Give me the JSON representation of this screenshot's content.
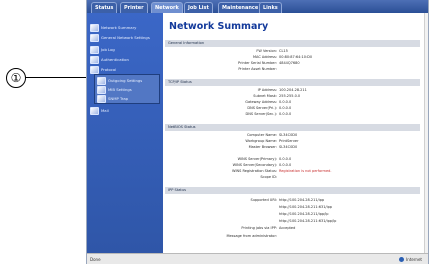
{
  "callout": "①",
  "tabs": [
    "Status",
    "Printer",
    "Network",
    "Job List",
    "Maintenance",
    "Links"
  ],
  "sidebar": {
    "items": [
      "Network Summary",
      "General Network Settings",
      "Job Log",
      "Authentication",
      "Protocol"
    ],
    "sub_items": [
      "Outgoing Settings",
      "MIB Settings",
      "SNMP Trap"
    ],
    "last_item": "Mail"
  },
  "title": "Network Summary",
  "general": {
    "header": "General Information",
    "rows": [
      [
        "FW Version:",
        "CL15"
      ],
      [
        "MAC Address:",
        "00:80:87:64:10:D0"
      ],
      [
        "Printer Serial Number:",
        "4844Q7680"
      ],
      [
        "Printer Asset Number:",
        ""
      ]
    ]
  },
  "tcpip": {
    "header": "TCP/IP Status",
    "rows": [
      [
        "IP Address:",
        "100.204.28.211"
      ],
      [
        "Subnet Mask:",
        "255.255.0.0"
      ],
      [
        "Gateway Address:",
        "0.0.0.0"
      ],
      [
        "DNS Server(Pri.):",
        "0.0.0.0"
      ],
      [
        "DNS Server(Sec.):",
        "0.0.0.0"
      ]
    ]
  },
  "netbios": {
    "header": "NetBIOS Status",
    "rows": [
      [
        "Computer Name:",
        "SL34C0D0"
      ],
      [
        "Workgroup Name:",
        "PrintServer"
      ],
      [
        "Master Browser:",
        "SL34C0D0"
      ],
      [
        "",
        ""
      ],
      [
        "WINS Server(Primary):",
        "0.0.0.0"
      ],
      [
        "WINS Server(Secondary):",
        "0.0.0.0"
      ],
      [
        "WINS Registration Status:",
        "Registration is not performed."
      ],
      [
        "Scope ID:",
        ""
      ]
    ]
  },
  "ipp": {
    "header": "IPP Status",
    "rows": [
      [
        "Supported URI:",
        "http://100.204.28.211/ipp"
      ],
      [
        "",
        "http://100.204.28.211:631/ipp"
      ],
      [
        "",
        "http://100.204.28.211/ipp/lp"
      ],
      [
        "",
        "http://100.204.28.211:631/ipp/lp"
      ],
      [
        "Printing jobs via IPP:",
        "Accepted"
      ],
      [
        "Message from administrator:",
        ""
      ]
    ]
  },
  "status": {
    "left": "Done",
    "right": "Internet"
  }
}
